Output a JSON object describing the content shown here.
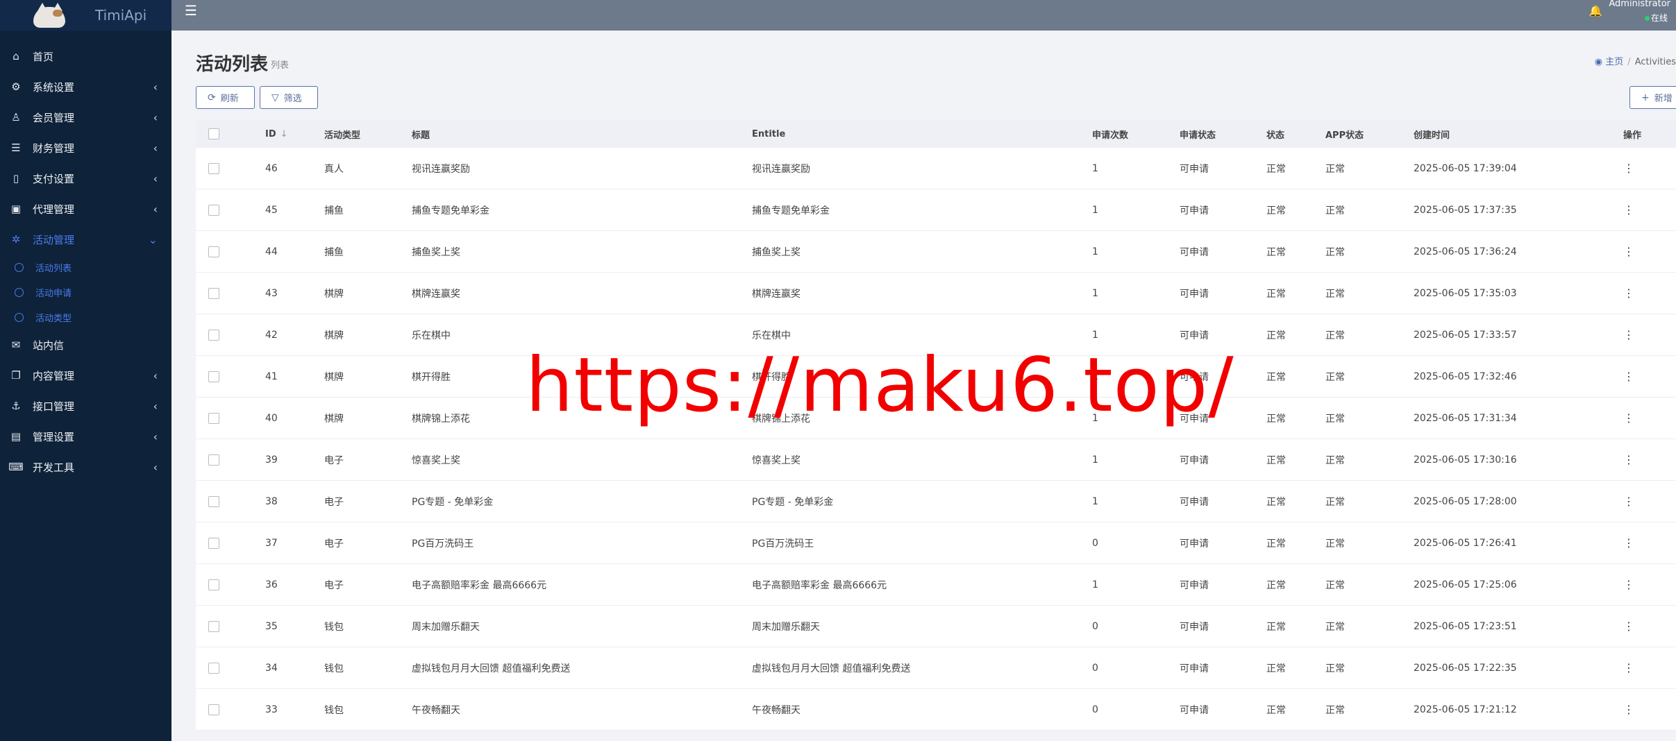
{
  "app": {
    "name": "TimiApi"
  },
  "sidebar": {
    "items": [
      {
        "label": "首页",
        "icon": "home-icon",
        "glyph": "⌂",
        "has_arrow": false
      },
      {
        "label": "系统设置",
        "icon": "gears-icon",
        "glyph": "⚙",
        "has_arrow": true
      },
      {
        "label": "会员管理",
        "icon": "user-icon",
        "glyph": "♙",
        "has_arrow": true
      },
      {
        "label": "财务管理",
        "icon": "database-icon",
        "glyph": "☰",
        "has_arrow": true
      },
      {
        "label": "支付设置",
        "icon": "bookmark-icon",
        "glyph": "▯",
        "has_arrow": true
      },
      {
        "label": "代理管理",
        "icon": "id-badge-icon",
        "glyph": "▣",
        "has_arrow": true
      },
      {
        "label": "活动管理",
        "icon": "activity-icon",
        "glyph": "✲",
        "has_arrow": true,
        "active": true
      },
      {
        "label": "站内信",
        "icon": "envelope-icon",
        "glyph": "✉",
        "has_arrow": false
      },
      {
        "label": "内容管理",
        "icon": "copy-icon",
        "glyph": "❐",
        "has_arrow": true
      },
      {
        "label": "接口管理",
        "icon": "anchor-icon",
        "glyph": "⚓",
        "has_arrow": true
      },
      {
        "label": "管理设置",
        "icon": "id-card-icon",
        "glyph": "▤",
        "has_arrow": true
      },
      {
        "label": "开发工具",
        "icon": "keyboard-icon",
        "glyph": "⌨",
        "has_arrow": true
      }
    ],
    "submenu": [
      "活动列表",
      "活动申请",
      "活动类型"
    ]
  },
  "topbar": {
    "user_name": "Administrator",
    "user_status": "在线"
  },
  "page": {
    "title": "活动列表",
    "subtitle": "列表",
    "breadcrumb_home": "主页",
    "breadcrumb_current": "Activities"
  },
  "toolbar": {
    "refresh": "刷新",
    "filter": "筛选",
    "add": "新增"
  },
  "table": {
    "headers": {
      "id": "ID",
      "type": "活动类型",
      "title": "标题",
      "entitle": "Entitle",
      "count": "申请次数",
      "apply_status": "申请状态",
      "status": "状态",
      "app_status": "APP状态",
      "created": "创建时间",
      "op": "操作"
    },
    "rows": [
      {
        "id": "46",
        "type": "真人",
        "title": "视讯连赢奖励",
        "entitle": "视讯连赢奖励",
        "count": "1",
        "apply": "可申请",
        "status": "正常",
        "app": "正常",
        "time": "2025-06-05 17:39:04"
      },
      {
        "id": "45",
        "type": "捕鱼",
        "title": "捕鱼专题免单彩金",
        "entitle": "捕鱼专题免单彩金",
        "count": "1",
        "apply": "可申请",
        "status": "正常",
        "app": "正常",
        "time": "2025-06-05 17:37:35"
      },
      {
        "id": "44",
        "type": "捕鱼",
        "title": "捕鱼奖上奖",
        "entitle": "捕鱼奖上奖",
        "count": "1",
        "apply": "可申请",
        "status": "正常",
        "app": "正常",
        "time": "2025-06-05 17:36:24"
      },
      {
        "id": "43",
        "type": "棋牌",
        "title": "棋牌连赢奖",
        "entitle": "棋牌连赢奖",
        "count": "1",
        "apply": "可申请",
        "status": "正常",
        "app": "正常",
        "time": "2025-06-05 17:35:03"
      },
      {
        "id": "42",
        "type": "棋牌",
        "title": "乐在棋中",
        "entitle": "乐在棋中",
        "count": "1",
        "apply": "可申请",
        "status": "正常",
        "app": "正常",
        "time": "2025-06-05 17:33:57"
      },
      {
        "id": "41",
        "type": "棋牌",
        "title": "棋开得胜",
        "entitle": "棋开得胜",
        "count": "1",
        "apply": "可申请",
        "status": "正常",
        "app": "正常",
        "time": "2025-06-05 17:32:46"
      },
      {
        "id": "40",
        "type": "棋牌",
        "title": "棋牌锦上添花",
        "entitle": "棋牌锦上添花",
        "count": "1",
        "apply": "可申请",
        "status": "正常",
        "app": "正常",
        "time": "2025-06-05 17:31:34"
      },
      {
        "id": "39",
        "type": "电子",
        "title": "惊喜奖上奖",
        "entitle": "惊喜奖上奖",
        "count": "1",
        "apply": "可申请",
        "status": "正常",
        "app": "正常",
        "time": "2025-06-05 17:30:16"
      },
      {
        "id": "38",
        "type": "电子",
        "title": "PG专题 - 免单彩金",
        "entitle": "PG专题 - 免单彩金",
        "count": "1",
        "apply": "可申请",
        "status": "正常",
        "app": "正常",
        "time": "2025-06-05 17:28:00"
      },
      {
        "id": "37",
        "type": "电子",
        "title": "PG百万洗码王",
        "entitle": "PG百万洗码王",
        "count": "0",
        "apply": "可申请",
        "status": "正常",
        "app": "正常",
        "time": "2025-06-05 17:26:41"
      },
      {
        "id": "36",
        "type": "电子",
        "title": "电子高额赔率彩金 最高6666元",
        "entitle": "电子高额赔率彩金 最高6666元",
        "count": "1",
        "apply": "可申请",
        "status": "正常",
        "app": "正常",
        "time": "2025-06-05 17:25:06"
      },
      {
        "id": "35",
        "type": "钱包",
        "title": "周末加赠乐翻天",
        "entitle": "周末加赠乐翻天",
        "count": "0",
        "apply": "可申请",
        "status": "正常",
        "app": "正常",
        "time": "2025-06-05 17:23:51"
      },
      {
        "id": "34",
        "type": "钱包",
        "title": "虚拟钱包月月大回馈 超值福利免费送",
        "entitle": "虚拟钱包月月大回馈 超值福利免费送",
        "count": "0",
        "apply": "可申请",
        "status": "正常",
        "app": "正常",
        "time": "2025-06-05 17:22:35"
      },
      {
        "id": "33",
        "type": "钱包",
        "title": "午夜畅翻天",
        "entitle": "午夜畅翻天",
        "count": "0",
        "apply": "可申请",
        "status": "正常",
        "app": "正常",
        "time": "2025-06-05 17:21:12"
      }
    ]
  },
  "watermark": "https://maku6.top/",
  "colors": {
    "sidebar_bg": "#0e2239",
    "topbar_bg": "#6d7a8c",
    "accent": "#4a7df0",
    "watermark": "#f20000"
  }
}
